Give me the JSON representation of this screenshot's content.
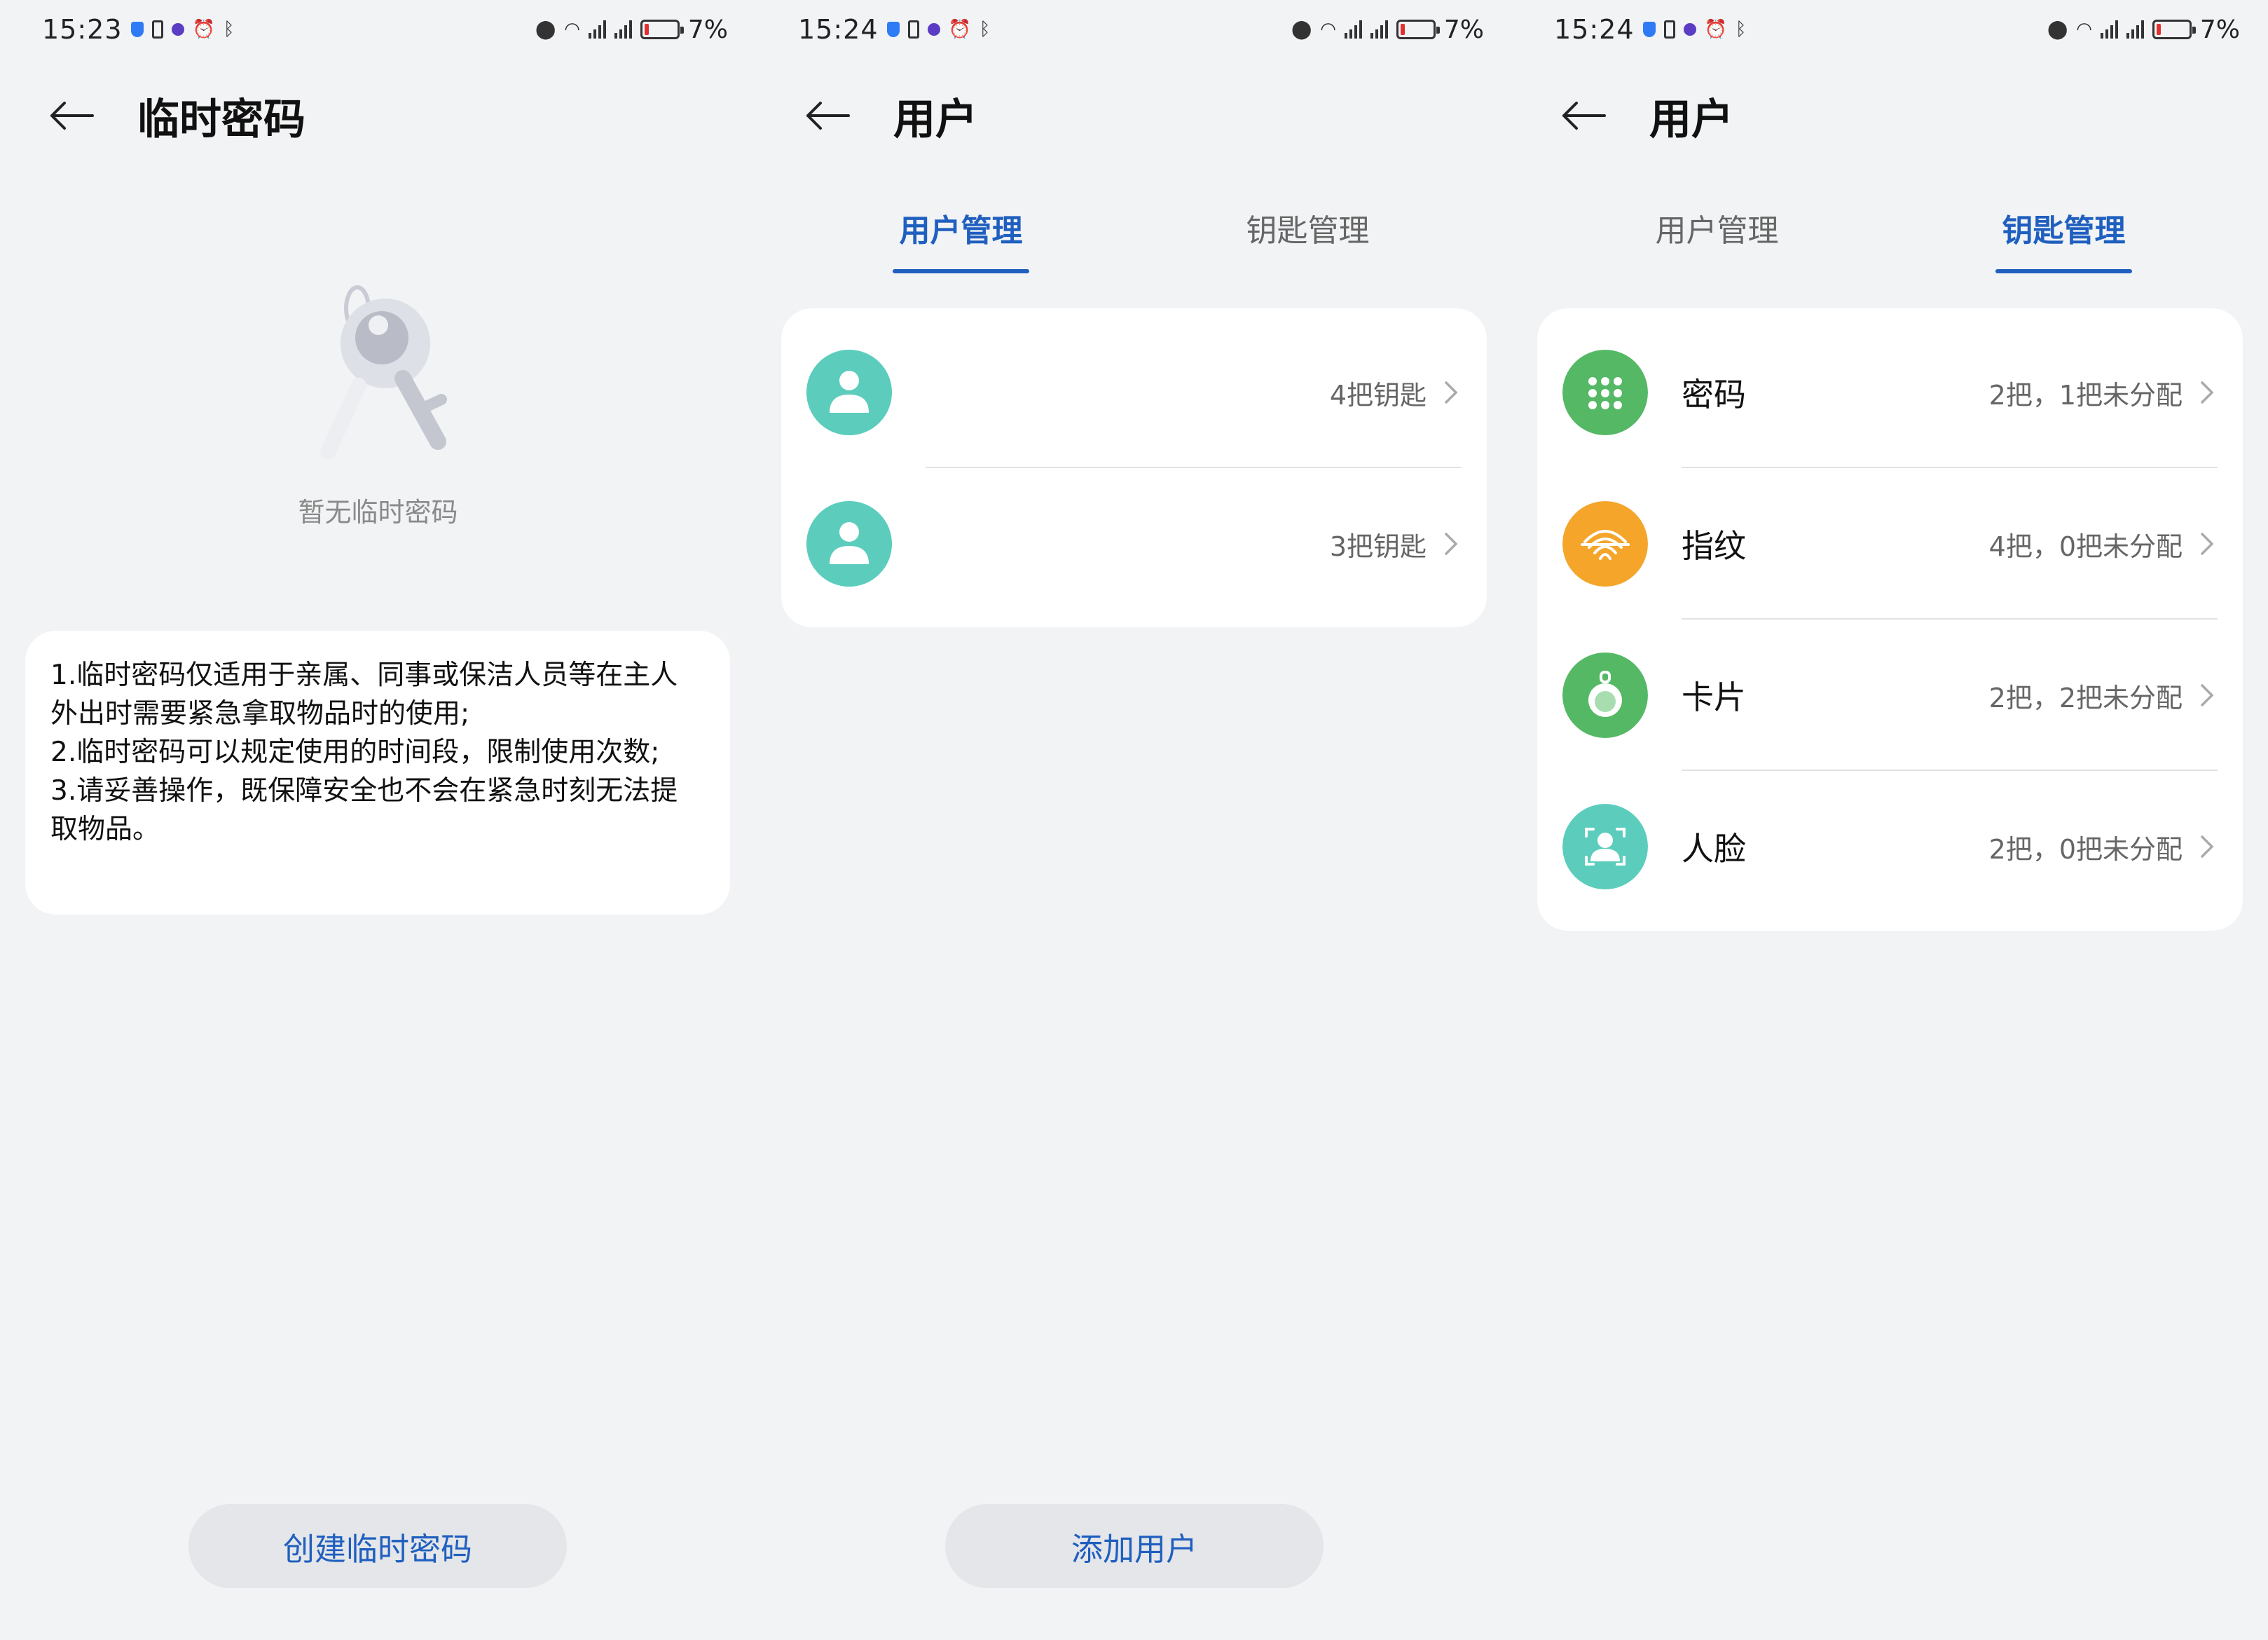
{
  "screen1": {
    "status": {
      "time": "15:23",
      "battery": "7%"
    },
    "title": "临时密码",
    "empty_text": "暂无临时密码",
    "info_lines": [
      "1.临时密码仅适用于亲属、同事或保洁人员等在主人外出时需要紧急拿取物品时的使用;",
      "2.临时密码可以规定使用的时间段，限制使用次数;",
      "3.请妥善操作，既保障安全也不会在紧急时刻无法提取物品。"
    ],
    "button": "创建临时密码"
  },
  "screen2": {
    "status": {
      "time": "15:24",
      "battery": "7%"
    },
    "title": "用户",
    "tabs": [
      "用户管理",
      "钥匙管理"
    ],
    "active_tab": 0,
    "users": [
      {
        "keys": "4把钥匙"
      },
      {
        "keys": "3把钥匙"
      }
    ],
    "button": "添加用户"
  },
  "screen3": {
    "status": {
      "time": "15:24",
      "battery": "7%"
    },
    "title": "用户",
    "tabs": [
      "用户管理",
      "钥匙管理"
    ],
    "active_tab": 1,
    "keys": [
      {
        "label": "密码",
        "value": "2把，1把未分配",
        "icon": "keypad-icon",
        "color": "#55b865"
      },
      {
        "label": "指纹",
        "value": "4把，0把未分配",
        "icon": "fingerprint-icon",
        "color": "#f4a52a"
      },
      {
        "label": "卡片",
        "value": "2把，2把未分配",
        "icon": "keyfob-icon",
        "color": "#55b865"
      },
      {
        "label": "人脸",
        "value": "2把，0把未分配",
        "icon": "face-scan-icon",
        "color": "#5ccdbd"
      }
    ]
  },
  "colors": {
    "accent": "#1f5fbf",
    "avatar": "#5ccdbd",
    "background": "#f1f3f5"
  }
}
